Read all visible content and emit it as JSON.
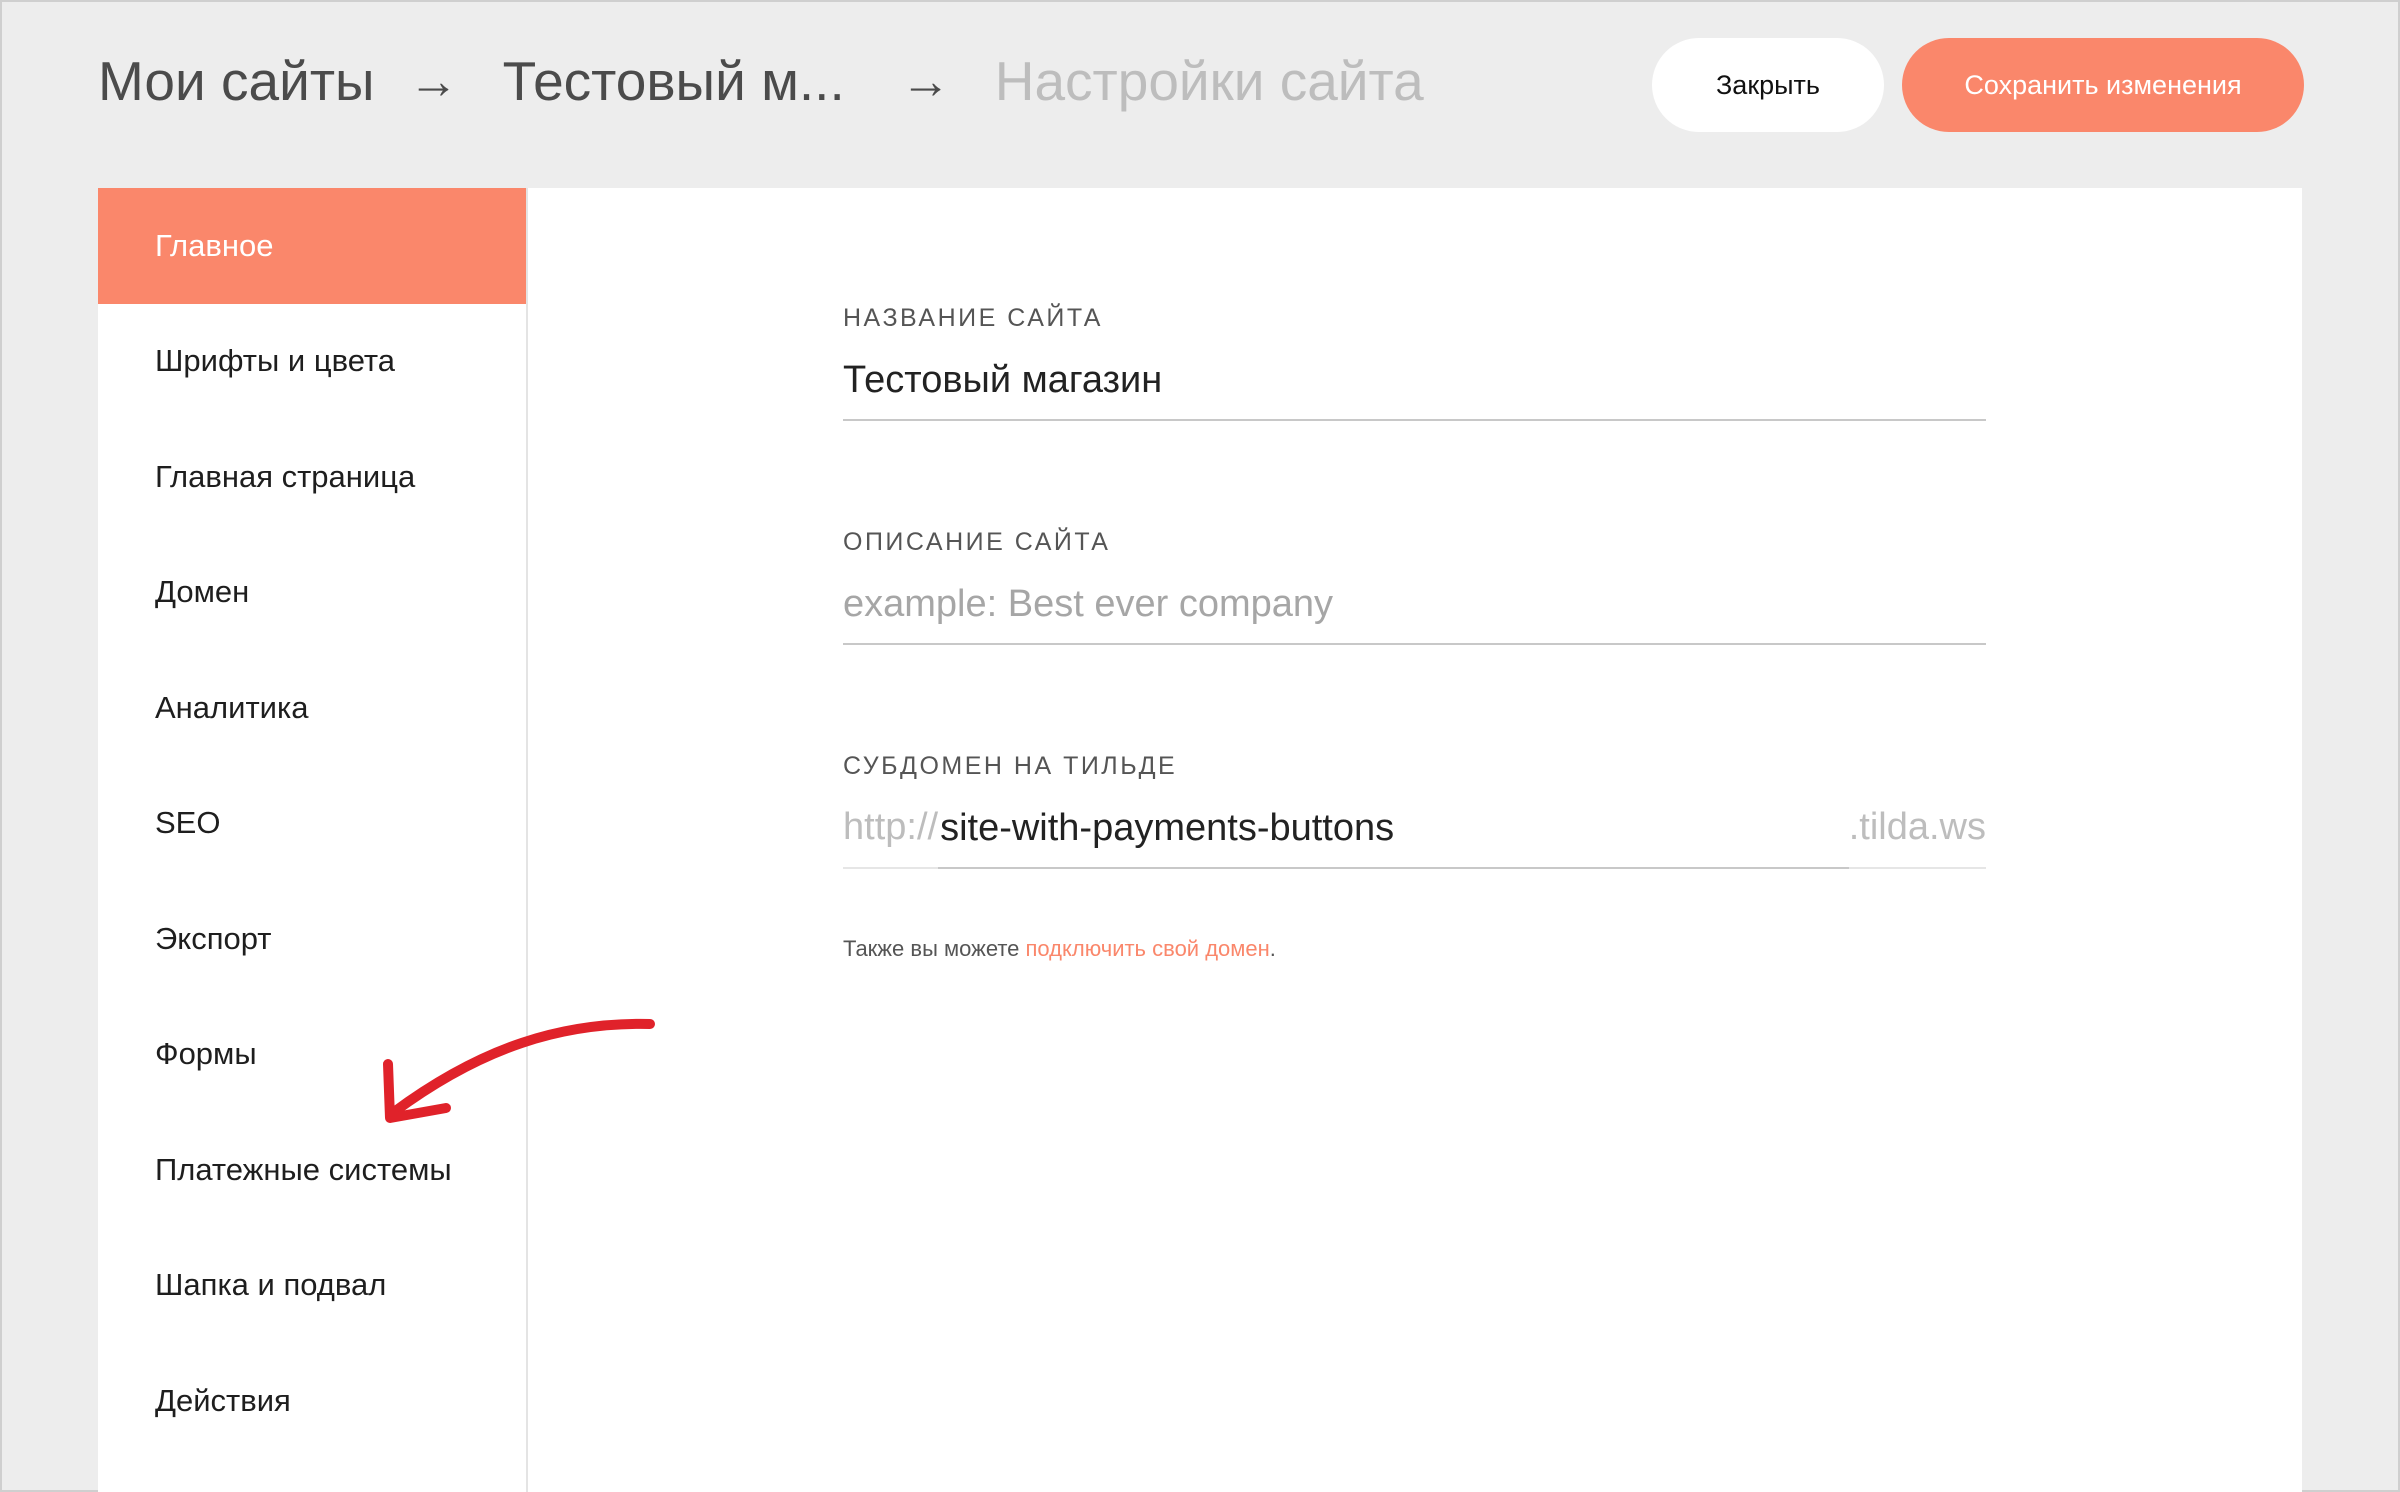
{
  "header": {
    "breadcrumb": {
      "my_sites": "Мои сайты",
      "site": "Тестовый м...",
      "current": "Настройки сайта",
      "separator": "→"
    },
    "close_label": "Закрыть",
    "save_label": "Сохранить изменения"
  },
  "sidebar": {
    "items": [
      {
        "label": "Главное",
        "active": true
      },
      {
        "label": "Шрифты и цвета"
      },
      {
        "label": "Главная страница"
      },
      {
        "label": "Домен"
      },
      {
        "label": "Аналитика"
      },
      {
        "label": "SEO"
      },
      {
        "label": "Экспорт"
      },
      {
        "label": "Формы"
      },
      {
        "label": "Платежные системы"
      },
      {
        "label": "Шапка и подвал"
      },
      {
        "label": "Действия"
      }
    ]
  },
  "main": {
    "site_name": {
      "label": "НАЗВАНИЕ САЙТА",
      "value": "Тестовый магазин"
    },
    "site_description": {
      "label": "ОПИСАНИЕ САЙТА",
      "value": "",
      "placeholder": "example: Best ever company"
    },
    "subdomain": {
      "label": "СУБДОМЕН НА ТИЛЬДЕ",
      "prefix": "http://",
      "value": "site-with-payments-buttons",
      "suffix": ".tilda.ws"
    },
    "domain_note": {
      "text": "Также вы можете ",
      "link": "подключить свой домен",
      "end": "."
    }
  },
  "annotation": {
    "arrow_color": "#e0222a",
    "points_to": "Платежные системы"
  },
  "colors": {
    "accent": "#fa876b",
    "background": "#ededed",
    "panel": "#ffffff"
  }
}
